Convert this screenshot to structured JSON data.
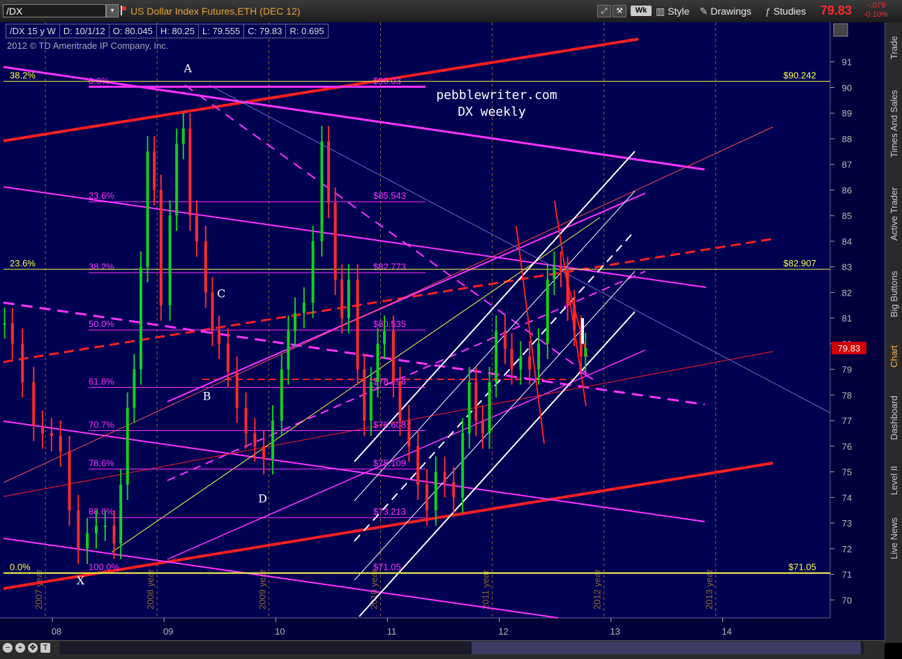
{
  "toolbar": {
    "symbol": "/DX",
    "description": "US Dollar Index Futures,ETH (DEC 12)",
    "aggregation": "Wk",
    "style_label": "Style",
    "drawings_label": "Drawings",
    "studies_label": "Studies",
    "last_price": "79.83",
    "net_change": "-.079",
    "pct_change": "-0.10%"
  },
  "info": {
    "symbol_period": "/DX 15 y W",
    "date": "D: 10/1/12",
    "open": "O: 80.045",
    "high": "H: 80.25",
    "low": "L: 79.555",
    "close": "C: 79.83",
    "range": "R: 0.695"
  },
  "copyright": "2012 © TD Ameritrade IP Company, Inc.",
  "side_tabs": [
    "Trade",
    "Times And Sales",
    "Active Trader",
    "Big Buttons",
    "Chart",
    "Dashboard",
    "Level II",
    "Live News"
  ],
  "chart_data": {
    "type": "candlestick",
    "title": "pebblewriter.com",
    "subtitle": "DX weekly",
    "ylim": [
      69.3,
      92.0
    ],
    "xlim": [
      2007.55,
      2014.95
    ],
    "y_ticks": [
      70,
      71,
      72,
      73,
      74,
      75,
      76,
      77,
      78,
      79,
      80,
      81,
      82,
      83,
      84,
      85,
      86,
      87,
      88,
      89,
      90,
      91
    ],
    "x_tick_labels": [
      "08",
      "09",
      "10",
      "11",
      "12",
      "13",
      "14"
    ],
    "year_labels": [
      "2007 year",
      "2008 year",
      "2009 year",
      "2010 year",
      "2011 year",
      "2012 year",
      "2013 year"
    ],
    "price_series": [
      {
        "t": 2007.56,
        "v": 80.8
      },
      {
        "t": 2007.63,
        "v": 80.0
      },
      {
        "t": 2007.72,
        "v": 78.5
      },
      {
        "t": 2007.82,
        "v": 76.8
      },
      {
        "t": 2007.9,
        "v": 76.5
      },
      {
        "t": 2007.98,
        "v": 76.4
      },
      {
        "t": 2008.06,
        "v": 75.8
      },
      {
        "t": 2008.14,
        "v": 73.5
      },
      {
        "t": 2008.22,
        "v": 72.0
      },
      {
        "t": 2008.3,
        "v": 72.6
      },
      {
        "t": 2008.38,
        "v": 72.9
      },
      {
        "t": 2008.46,
        "v": 72.9
      },
      {
        "t": 2008.54,
        "v": 72.2
      },
      {
        "t": 2008.6,
        "v": 74.5
      },
      {
        "t": 2008.66,
        "v": 77.5
      },
      {
        "t": 2008.72,
        "v": 79.0
      },
      {
        "t": 2008.78,
        "v": 83.0
      },
      {
        "t": 2008.84,
        "v": 87.5
      },
      {
        "t": 2008.9,
        "v": 86.0
      },
      {
        "t": 2008.96,
        "v": 81.5
      },
      {
        "t": 2009.04,
        "v": 85.0
      },
      {
        "t": 2009.1,
        "v": 87.8
      },
      {
        "t": 2009.16,
        "v": 88.4
      },
      {
        "t": 2009.22,
        "v": 85.0
      },
      {
        "t": 2009.28,
        "v": 84.0
      },
      {
        "t": 2009.36,
        "v": 82.0
      },
      {
        "t": 2009.42,
        "v": 80.5
      },
      {
        "t": 2009.48,
        "v": 80.0
      },
      {
        "t": 2009.56,
        "v": 78.9
      },
      {
        "t": 2009.64,
        "v": 77.5
      },
      {
        "t": 2009.72,
        "v": 76.5
      },
      {
        "t": 2009.8,
        "v": 76.0
      },
      {
        "t": 2009.88,
        "v": 75.5
      },
      {
        "t": 2009.96,
        "v": 77.0
      },
      {
        "t": 2010.04,
        "v": 79.0
      },
      {
        "t": 2010.1,
        "v": 80.5
      },
      {
        "t": 2010.16,
        "v": 81.2
      },
      {
        "t": 2010.24,
        "v": 81.6
      },
      {
        "t": 2010.32,
        "v": 84.0
      },
      {
        "t": 2010.4,
        "v": 87.9
      },
      {
        "t": 2010.46,
        "v": 85.5
      },
      {
        "t": 2010.52,
        "v": 82.5
      },
      {
        "t": 2010.58,
        "v": 81.0
      },
      {
        "t": 2010.64,
        "v": 82.5
      },
      {
        "t": 2010.72,
        "v": 79.0
      },
      {
        "t": 2010.78,
        "v": 77.0
      },
      {
        "t": 2010.84,
        "v": 78.5
      },
      {
        "t": 2010.9,
        "v": 80.0
      },
      {
        "t": 2010.96,
        "v": 80.5
      },
      {
        "t": 2011.04,
        "v": 78.5
      },
      {
        "t": 2011.1,
        "v": 77.0
      },
      {
        "t": 2011.18,
        "v": 76.0
      },
      {
        "t": 2011.26,
        "v": 74.5
      },
      {
        "t": 2011.34,
        "v": 73.5
      },
      {
        "t": 2011.42,
        "v": 75.0
      },
      {
        "t": 2011.5,
        "v": 74.6
      },
      {
        "t": 2011.58,
        "v": 74.0
      },
      {
        "t": 2011.66,
        "v": 76.5
      },
      {
        "t": 2011.72,
        "v": 78.5
      },
      {
        "t": 2011.78,
        "v": 77.0
      },
      {
        "t": 2011.84,
        "v": 76.5
      },
      {
        "t": 2011.9,
        "v": 78.5
      },
      {
        "t": 2011.96,
        "v": 80.5
      },
      {
        "t": 2012.04,
        "v": 79.8
      },
      {
        "t": 2012.1,
        "v": 79.0
      },
      {
        "t": 2012.18,
        "v": 79.5
      },
      {
        "t": 2012.26,
        "v": 79.0
      },
      {
        "t": 2012.34,
        "v": 80.0
      },
      {
        "t": 2012.42,
        "v": 82.5
      },
      {
        "t": 2012.48,
        "v": 83.0
      },
      {
        "t": 2012.54,
        "v": 82.8
      },
      {
        "t": 2012.6,
        "v": 81.5
      },
      {
        "t": 2012.66,
        "v": 80.5
      },
      {
        "t": 2012.72,
        "v": 79.5
      },
      {
        "t": 2012.76,
        "v": 79.83
      }
    ],
    "fib_levels": [
      {
        "pct": "0.0%",
        "value": 90.03,
        "label": "$90.03"
      },
      {
        "pct": "23.6%",
        "value": 85.543,
        "label": "$85.543"
      },
      {
        "pct": "38.2%",
        "value": 82.773,
        "label": "$82.773"
      },
      {
        "pct": "50.0%",
        "value": 80.535,
        "label": "$80.535"
      },
      {
        "pct": "61.8%",
        "value": 78.296,
        "label": "$78.296"
      },
      {
        "pct": "70.7%",
        "value": 76.608,
        "label": "$76.608"
      },
      {
        "pct": "78.6%",
        "value": 75.109,
        "label": "$75.109"
      },
      {
        "pct": "88.6%",
        "value": 73.213,
        "label": "$73.213"
      },
      {
        "pct": "100.0%",
        "value": 71.05,
        "label": "$71.05"
      }
    ],
    "horizontal_levels": [
      {
        "left_label": "38.2%",
        "value": 90.242,
        "right_label": "$90.242"
      },
      {
        "left_label": "23.6%",
        "value": 82.907,
        "right_label": "$82.907"
      },
      {
        "left_label": "0.0%",
        "value": 71.05,
        "right_label": "$71.05"
      }
    ],
    "wave_labels": [
      {
        "text": "A",
        "t": 2009.2,
        "v": 90.6
      },
      {
        "text": "B",
        "t": 2009.37,
        "v": 77.8
      },
      {
        "text": "C",
        "t": 2009.5,
        "v": 81.8
      },
      {
        "text": "D",
        "t": 2009.87,
        "v": 73.8
      },
      {
        "text": "X",
        "t": 2008.24,
        "v": 70.6
      }
    ],
    "price_marker": "79.83",
    "colors": {
      "background": "#000052",
      "price_up": "#11d11a",
      "price_down": "#ff2b2b",
      "fib": "#ff33ff",
      "trend_red": "#ff2020",
      "level": "#ffff44",
      "channel": "#ffffff"
    }
  }
}
